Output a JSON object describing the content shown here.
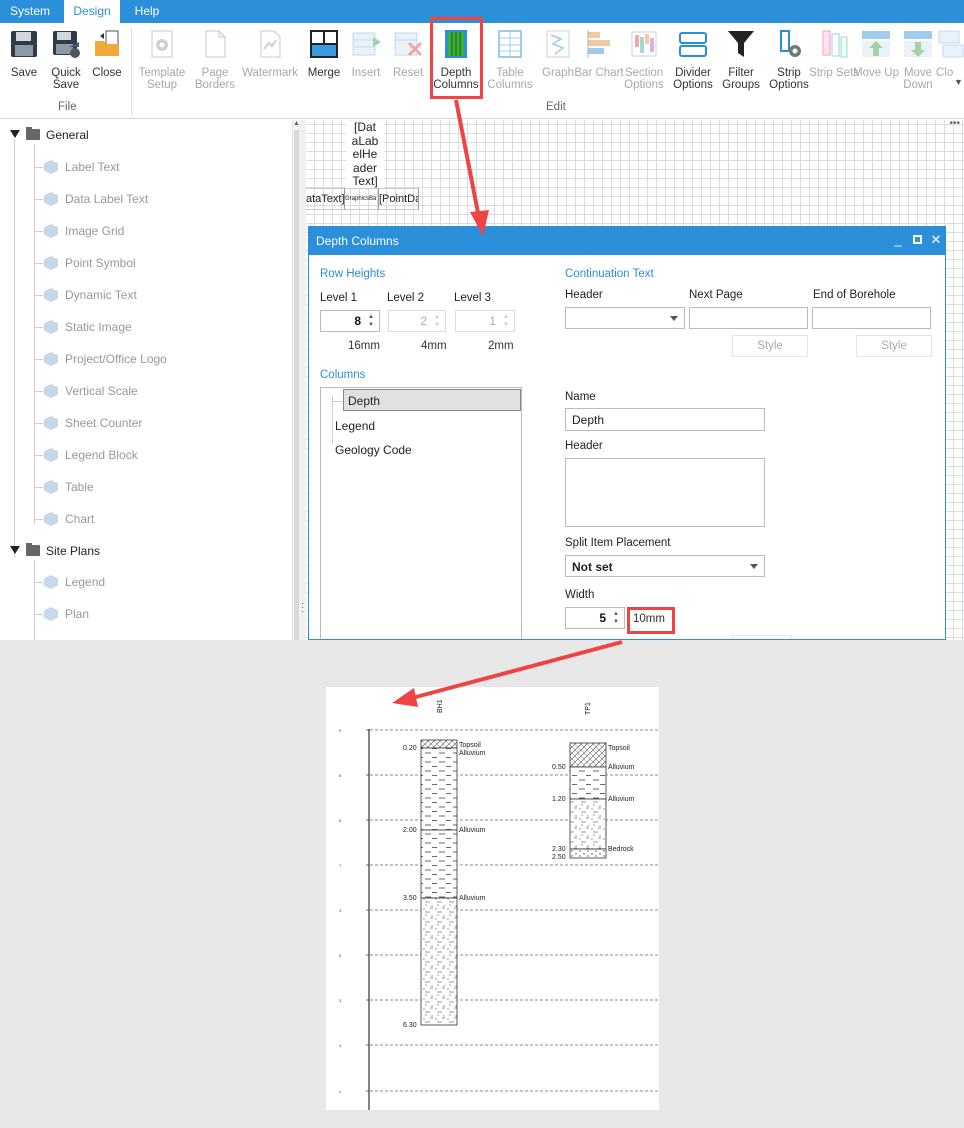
{
  "menu": {
    "tabs": [
      "System",
      "Design",
      "Help"
    ],
    "active_tab": "Design"
  },
  "ribbon": {
    "file_group_label": "File",
    "edit_group_label": "Edit",
    "file_buttons": [
      {
        "label": "Save",
        "icon": "floppy-disk-icon"
      },
      {
        "label": "Quick Save",
        "icon": "quick-save-icon"
      },
      {
        "label": "Close",
        "icon": "close-folder-icon"
      }
    ],
    "edit_buttons": [
      {
        "label": "Template Setup",
        "icon": "gear-page-icon",
        "enabled": false
      },
      {
        "label": "Page Borders",
        "icon": "page-icon",
        "enabled": false
      },
      {
        "label": "Watermark",
        "icon": "watermark-icon",
        "enabled": false
      },
      {
        "label": "Merge",
        "icon": "merge-grid-icon",
        "enabled": true
      },
      {
        "label": "Insert",
        "icon": "insert-icon",
        "enabled": false
      },
      {
        "label": "Reset",
        "icon": "reset-icon",
        "enabled": false
      },
      {
        "label": "Depth Columns",
        "icon": "depth-columns-icon",
        "enabled": true
      },
      {
        "label": "Table Columns",
        "icon": "table-columns-icon",
        "enabled": false
      },
      {
        "label": "Graph",
        "icon": "graph-icon",
        "enabled": false
      },
      {
        "label": "Bar Chart",
        "icon": "bar-chart-icon",
        "enabled": false
      },
      {
        "label": "Section Options",
        "icon": "section-options-icon",
        "enabled": false
      },
      {
        "label": "Divider Options",
        "icon": "divider-options-icon",
        "enabled": true
      },
      {
        "label": "Filter Groups",
        "icon": "filter-icon",
        "enabled": true
      },
      {
        "label": "Strip Options",
        "icon": "strip-options-icon",
        "enabled": true
      },
      {
        "label": "Strip Sets",
        "icon": "strip-sets-icon",
        "enabled": false
      },
      {
        "label": "Move Up",
        "icon": "move-up-icon",
        "enabled": false
      },
      {
        "label": "Move Down",
        "icon": "move-down-icon",
        "enabled": false
      },
      {
        "label": "Clo",
        "icon": "clone-icon",
        "enabled": false
      }
    ]
  },
  "tree": {
    "groups": [
      {
        "label": "General",
        "items": [
          "Label Text",
          "Data Label Text",
          "Image Grid",
          "Point Symbol",
          "Dynamic Text",
          "Static Image",
          "Project/Office Logo",
          "Vertical Scale",
          "Sheet Counter",
          "Legend Block",
          "Table",
          "Chart"
        ]
      },
      {
        "label": "Site Plans",
        "items": [
          "Legend",
          "Plan"
        ]
      }
    ]
  },
  "canvas": {
    "label_lines": [
      "[Dat",
      "aLab",
      "elHe",
      "ader",
      "Text]"
    ],
    "cells": [
      "ataText]",
      "GraphicsBa",
      "[PointDa"
    ]
  },
  "dialog": {
    "title": "Depth Columns",
    "row_heights": {
      "section": "Row Heights",
      "levels": [
        {
          "label": "Level 1",
          "value": "8",
          "mm": "16mm",
          "enabled": true
        },
        {
          "label": "Level 2",
          "value": "2",
          "mm": "4mm",
          "enabled": false
        },
        {
          "label": "Level 3",
          "value": "1",
          "mm": "2mm",
          "enabled": false
        }
      ]
    },
    "continuation": {
      "section": "Continuation Text",
      "header_label": "Header",
      "next_page_label": "Next Page",
      "end_label": "End of Borehole",
      "style_label": "Style"
    },
    "columns": {
      "section": "Columns",
      "items": [
        "Depth",
        "Legend",
        "Geology Code"
      ],
      "selected": "Depth"
    },
    "name": {
      "label": "Name",
      "value": "Depth"
    },
    "header": {
      "label": "Header",
      "value": ""
    },
    "split": {
      "label": "Split Item Placement",
      "value": "Not set"
    },
    "width": {
      "label": "Width",
      "value": "5",
      "mm": "10mm"
    }
  },
  "preview": {
    "boreholes": [
      {
        "name": "BH1",
        "layers": [
          {
            "depth": "0.20",
            "label": "Topsoil"
          },
          {
            "depth": "",
            "label": "Alluvium"
          },
          {
            "depth": "2.00",
            "label": "Alluvium"
          },
          {
            "depth": "3.50",
            "label": "Alluvium"
          },
          {
            "depth": "6.30",
            "label": ""
          }
        ]
      },
      {
        "name": "TP1",
        "layers": [
          {
            "depth": "",
            "label": "Topsoil"
          },
          {
            "depth": "0.50",
            "label": "Alluvium"
          },
          {
            "depth": "1.20",
            "label": "Alluvium"
          },
          {
            "depth": "2.30",
            "label": "Bedrock"
          },
          {
            "depth": "2.50",
            "label": ""
          }
        ]
      }
    ],
    "scale_ticks": [
      "9",
      "8",
      "6",
      "7",
      "4",
      "5",
      "3",
      "4",
      "2"
    ]
  },
  "colors": {
    "accent": "#2b8fd9",
    "highlight": "#ef4444"
  }
}
